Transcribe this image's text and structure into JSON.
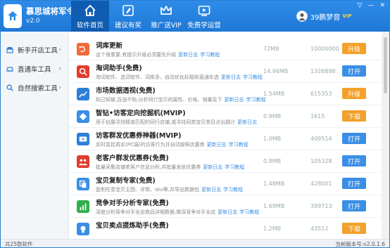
{
  "app": {
    "name": "慕思城将军令",
    "version": "v2.0"
  },
  "tabs": [
    {
      "label": "软件首页",
      "icon": "home-icon"
    },
    {
      "label": "建议有奖",
      "icon": "edit-icon"
    },
    {
      "label": "推广送VIP",
      "icon": "crown-icon"
    },
    {
      "label": "免费学运营",
      "icon": "video-icon"
    }
  ],
  "user": {
    "name": "39鹏梦音",
    "badge": "VIP"
  },
  "window_controls": [
    "▽",
    "—",
    "✕"
  ],
  "sidebar": {
    "items": [
      {
        "label": "新手开店工具",
        "icon": "shop-icon"
      },
      {
        "label": "直通车工具",
        "icon": "car-icon"
      },
      {
        "label": "自然搜索工具",
        "icon": "search-icon"
      }
    ]
  },
  "rows": [
    {
      "title": "词库更新",
      "desc": "这个很重要,有提示升级必须要先升级",
      "links": [
        "更新日志",
        "学习教程"
      ],
      "size": "72MB",
      "count": "10000000",
      "action": "升级",
      "icon": "refresh-icon",
      "icon_color": "#f26b3a"
    },
    {
      "title": "淘词助手(免费)",
      "desc": "淘词软件、选词软件、词库多、自动优化标题和直通车选",
      "links": [
        "更新日志",
        "学习教程"
      ],
      "size": "14.96MB",
      "count": "1326898",
      "action": "打开",
      "icon": "search-icon",
      "icon_color": "#e23c2c"
    },
    {
      "title": "市场数据透视(免费)",
      "desc": "知己知彼,百战不殆,分析同行宝贝的属性、价格、销量及下",
      "links": [
        "更新日志",
        "学习教程"
      ],
      "size": "1.54MB",
      "count": "615353",
      "action": "升级",
      "icon": "trend-icon",
      "icon_color": "#2c7fd8"
    },
    {
      "title": "智钻•访客定向挖掘机(MVIP)",
      "desc": "用于钻展寻找精准匹配的同行店铺,或寻找同类宝贝类目点出跳计",
      "links": [
        "更新日志"
      ],
      "size": "0.9MB",
      "count": "1615",
      "action": "下载",
      "icon": "diamond-icon",
      "icon_color": "#3a8ee6"
    },
    {
      "title": "访客群发优惠券神器(MVIP)",
      "desc": "实时监控真实(PC端)的访客行为并自动按照优惠券",
      "links": [
        "更新日志",
        "学习教程"
      ],
      "size": "1.0MB",
      "count": "409514",
      "action": "打开",
      "icon": "coupon-icon",
      "icon_color": "#2c7fd8"
    },
    {
      "title": "老客户群发优惠券(免费)",
      "desc": "批量采集店铺老客户信息分析,并批量发放优惠券",
      "links": [
        "更新日志",
        "学习教程"
      ],
      "size": "0.8MB",
      "count": "105328",
      "action": "打开",
      "icon": "group-icon",
      "icon_color": "#e23c2c"
    },
    {
      "title": "宝贝复制专家(免费)",
      "desc": "复制任意宝贝主图、详情、sku等,并导出数据包",
      "links": [
        "更新日志",
        "学习教程"
      ],
      "size": "1.48MB",
      "count": "428001",
      "action": "打开",
      "icon": "copy-icon",
      "icon_color": "#3a8ee6"
    },
    {
      "title": "竞争对手分析专家(免费)",
      "desc": "深度分析竞争对手全店商品详细数据,做深竞争对手全店",
      "links": [
        "更新日志",
        "学习教程"
      ],
      "size": "1.69MB",
      "count": "399713",
      "action": "打开",
      "icon": "chart-icon",
      "icon_color": "#2eaf4d"
    },
    {
      "title": "宝贝卖点提炼助手(免费)",
      "desc": "",
      "links": [],
      "size": "1.2MB",
      "count": "43512",
      "action": "下载",
      "icon": "bulb-icon",
      "icon_color": "#3a8ee6"
    }
  ],
  "footer": {
    "count_text": "共25款软件",
    "version_text": "当前版本号:v2.0.1.6"
  }
}
